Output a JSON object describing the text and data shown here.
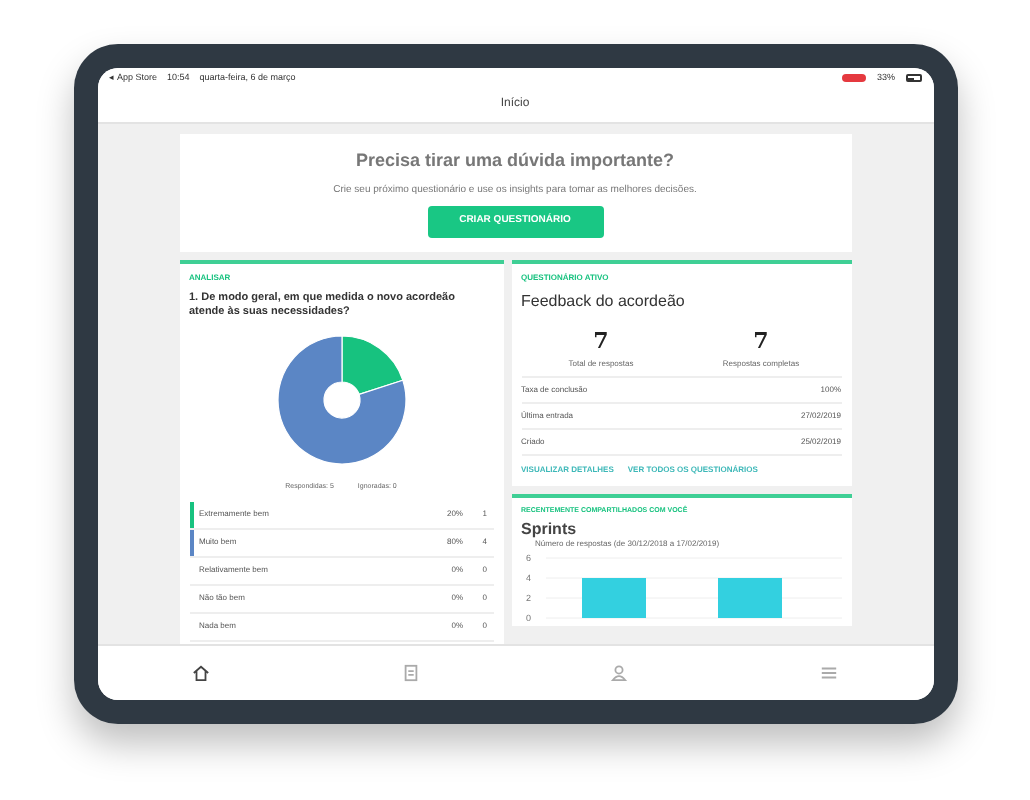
{
  "status_bar": {
    "carrier": "◂ App Store",
    "time": "10:54",
    "date": "quarta-feira, 6 de março",
    "battery": "33%"
  },
  "nav": {
    "title": "Início"
  },
  "banner": {
    "title": "Precisa tirar uma dúvida importante?",
    "text": "Crie seu próximo questionário e use os insights para tomar as melhores decisões.",
    "button": "CRIAR QUESTIONÁRIO"
  },
  "analysis": {
    "label": "ANALISAR",
    "question": "1. De modo geral, em que medida o novo acordeão atende às suas necessidades?",
    "legend": [
      "Respondidas: 5",
      "Ignoradas: 0"
    ],
    "rows": [
      {
        "label": "Extremamente bem",
        "percent": "20%",
        "count": "1",
        "color": "#17c27f"
      },
      {
        "label": "Muito bem",
        "percent": "80%",
        "count": "4",
        "color": "#5b86c5"
      },
      {
        "label": "Relativamente bem",
        "percent": "0%",
        "count": "0"
      },
      {
        "label": "Não tão bem",
        "percent": "0%",
        "count": "0"
      },
      {
        "label": "Nada bem",
        "percent": "0%",
        "count": "0"
      }
    ]
  },
  "active": {
    "label": "QUESTIONÁRIO ATIVO",
    "title": "Feedback do acordeão",
    "stats": [
      {
        "value": "7",
        "label": "Total de respostas"
      },
      {
        "value": "7",
        "label": "Respostas completas"
      }
    ],
    "rows": [
      {
        "label": "Taxa de conclusão",
        "value": "100%"
      },
      {
        "label": "Última entrada",
        "value": "27/02/2019"
      },
      {
        "label": "Criado",
        "value": "25/02/2019"
      }
    ],
    "links": [
      "VISUALIZAR DETALHES",
      "VER TODOS OS QUESTIONÁRIOS"
    ]
  },
  "shared": {
    "label": "RECENTEMENTE COMPARTILHADOS COM VOCÊ",
    "title": "Sprints",
    "chart_data": {
      "type": "bar",
      "title": "Número de respostas (de 30/12/2018 a 17/02/2019)",
      "values": [
        4,
        4
      ],
      "ylim": [
        0,
        6
      ],
      "yticks": [
        0,
        2,
        4,
        6
      ]
    }
  },
  "tabs": [
    {
      "kind": "home",
      "selected": true
    },
    {
      "kind": "list",
      "selected": false
    },
    {
      "kind": "user",
      "selected": false
    },
    {
      "kind": "menu",
      "selected": false
    }
  ]
}
